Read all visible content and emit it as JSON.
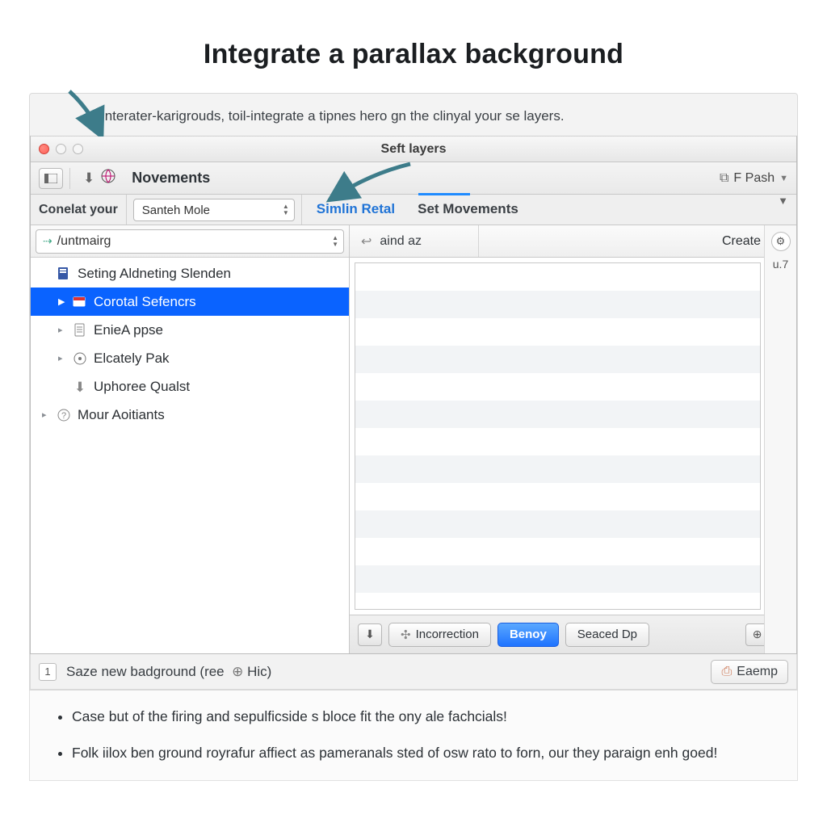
{
  "page": {
    "heading": "Integrate a parallax background",
    "intro": "Interater-karigrouds, toil-integrate a tipnes hero gn the clinyal your se layers."
  },
  "window": {
    "title": "Seft layers",
    "toolbar": {
      "section_label": "Novements",
      "right_label": "F Pash"
    },
    "filter": {
      "label": "Conelat your",
      "select_value": "Santeh Mole",
      "tab_active": "Simlin Retal",
      "tab_secondary": "Set Movements"
    },
    "side": {
      "path_value": "/untmairg",
      "tree": [
        {
          "label": "Seting Aldneting Slenden",
          "icon": "doc-badge",
          "selected": false,
          "child": false
        },
        {
          "label": "Corotal Sefencrs",
          "icon": "module",
          "selected": true,
          "child": true
        },
        {
          "label": "EnieA ppse",
          "icon": "page",
          "selected": false,
          "child": true
        },
        {
          "label": "Elcately Pak",
          "icon": "disk",
          "selected": false,
          "child": true
        },
        {
          "label": "Uphoree Qualst",
          "icon": "down",
          "selected": false,
          "child": true
        },
        {
          "label": "Mour Aoitiants",
          "icon": "help",
          "selected": false,
          "child": false
        }
      ]
    },
    "columns": {
      "c1": "aind az",
      "action_label": "Create"
    },
    "rightgutter": {
      "version": "u.7"
    },
    "footer": {
      "btn_incorrection": "Incorrection",
      "btn_primary": "Benoy",
      "btn_seaced": "Seaced Dp"
    }
  },
  "status": {
    "step": "1",
    "text": "Saze new badground (ree",
    "hint": "Hic)",
    "right_btn": "Eaemp"
  },
  "bullets": {
    "b1": "Case but of the firing and sepulficside s bloce fit the ony ale fachcials!",
    "b2": "Folk iilox ben ground royrafur affiect as pameranals sted of osw rato to forn, our they paraign enh goed!"
  }
}
